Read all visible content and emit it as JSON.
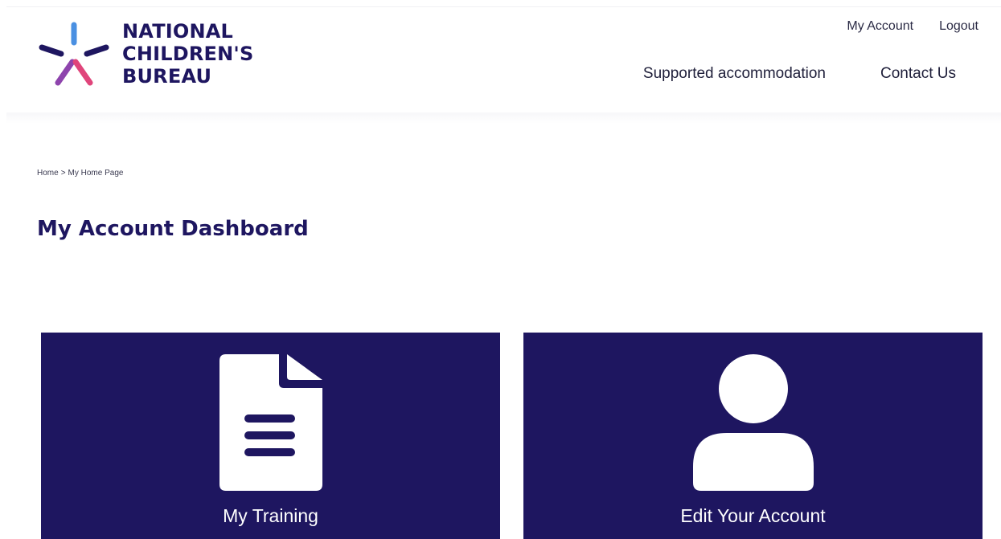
{
  "header": {
    "logo": {
      "line1": "NATIONAL",
      "line2": "CHILDREN'S",
      "line3": "BUREAU",
      "icon": "star-burst-logo-icon",
      "colors": [
        "#4a90e2",
        "#1e1660",
        "#8e44ad",
        "#e0457b"
      ]
    },
    "util_nav": {
      "my_account": "My Account",
      "logout": "Logout"
    },
    "main_nav": {
      "supported_accommodation": "Supported accommodation",
      "contact_us": "Contact Us"
    }
  },
  "breadcrumb": {
    "home": "Home",
    "separator": ">",
    "current": "My Home Page"
  },
  "page_title": "My Account Dashboard",
  "tiles": [
    {
      "label": "My Training",
      "icon": "document-icon"
    },
    {
      "label": "Edit Your Account",
      "icon": "user-icon"
    }
  ],
  "colors": {
    "brand_navy": "#1e1660",
    "tile_text": "#ffffff"
  }
}
